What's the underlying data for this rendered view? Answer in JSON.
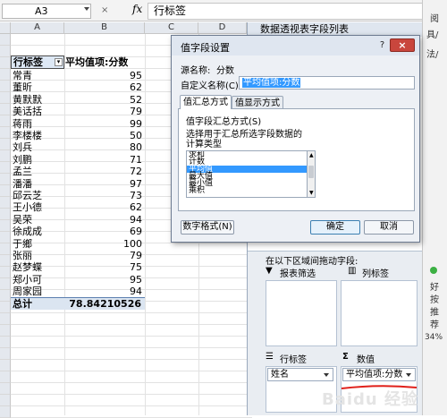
{
  "formula_bar": {
    "name_box": "A3",
    "fx_cancel": "×",
    "fx_label": "fx",
    "value": "行标签"
  },
  "columns": [
    "A",
    "B",
    "C",
    "D"
  ],
  "pivot": {
    "header_row": [
      "行标签",
      "平均值项:分数"
    ],
    "rows": [
      [
        "常青",
        "95"
      ],
      [
        "董昕",
        "62"
      ],
      [
        "黄默默",
        "52"
      ],
      [
        "美话括",
        "79"
      ],
      [
        "蒋雨",
        "99"
      ],
      [
        "李楼楼",
        "50"
      ],
      [
        "刘兵",
        "80"
      ],
      [
        "刘鹏",
        "71"
      ],
      [
        "孟兰",
        "72"
      ],
      [
        "潘潘",
        "97"
      ],
      [
        "邱云芝",
        "73"
      ],
      [
        "王小德",
        "62"
      ],
      [
        "吴荣",
        "94"
      ],
      [
        "徐成成",
        "69"
      ],
      [
        "于鄉",
        "100"
      ],
      [
        "张丽",
        "79"
      ],
      [
        "赵梦蝶",
        "75"
      ],
      [
        "郑小可",
        "95"
      ],
      [
        "周家园",
        "94"
      ]
    ],
    "total_label": "总计",
    "total_value": "78.84210526"
  },
  "task_pane": {
    "title": "数据透视表字段列表",
    "instruction": "在以下区域间拖动字段:",
    "report_filter": "报表筛选",
    "column_labels": "列标签",
    "row_labels": "行标签",
    "values": "数值",
    "sigma": "Σ",
    "row_field": "姓名",
    "value_field": "平均值项:分数"
  },
  "dialog": {
    "title": "值字段设置",
    "help": "?",
    "close": "×",
    "source_name_label": "源名称:",
    "source_name_value": "分数",
    "custom_name_label": "自定义名称(C):",
    "custom_name_value": "平均值项:分数",
    "tab_summarize": "值汇总方式",
    "tab_show_as": "值显示方式",
    "summarize_by_label": "值字段汇总方式(S)",
    "description_line1": "选择用于汇总所选字段数据的",
    "description_line2": "计算类型",
    "functions": [
      "求和",
      "计数",
      "平均值",
      "最大值",
      "最小值",
      "乘积"
    ],
    "selected_function": "平均值",
    "number_format_button": "数字格式(N)",
    "ok_button": "确定",
    "cancel_button": "取消"
  },
  "right_strip": {
    "items": [
      "阅",
      "具/",
      "法/",
      "好",
      "按",
      "推",
      "荐"
    ],
    "footer": "34%"
  },
  "watermark": "Baidu 经验",
  "colors": {
    "selection": "#3399ff",
    "header_fill": "#e4e8ee",
    "pane_fill": "#e9edf2",
    "close_red": "#c9463d",
    "annotation_red": "#e0201a"
  }
}
